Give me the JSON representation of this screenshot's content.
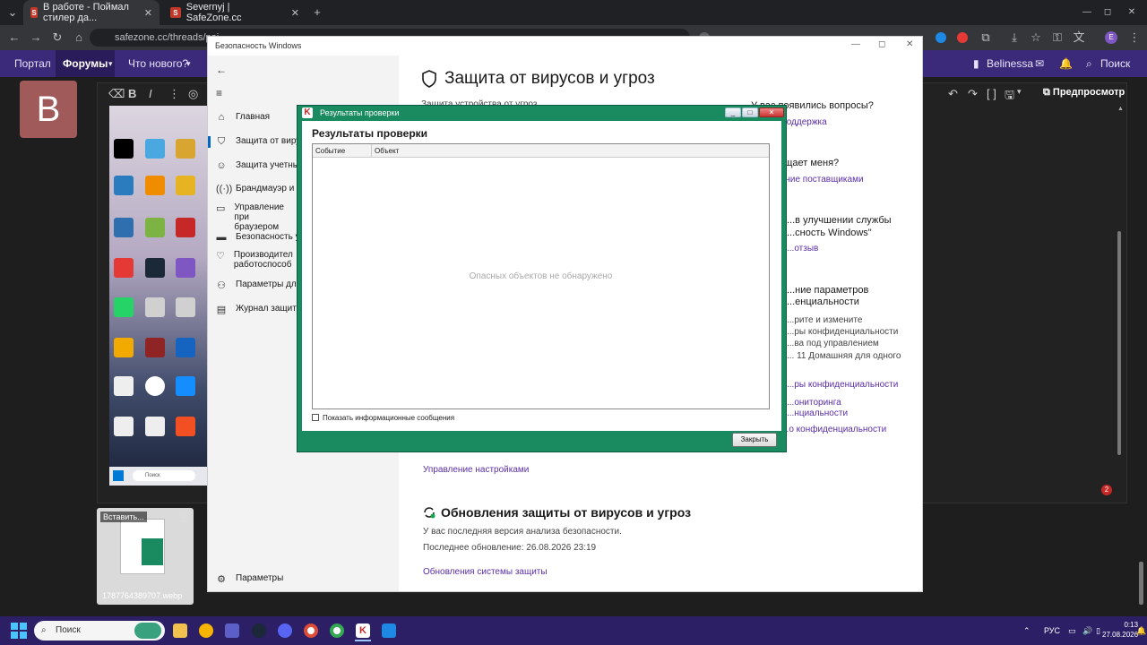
{
  "browser": {
    "tabs": [
      {
        "title": "В работе - Поймал стилер да..."
      },
      {
        "title": "Severnyj | SafeZone.cc"
      }
    ],
    "new_tab": "+",
    "url": "safezone.cc/threads/poi..."
  },
  "forum": {
    "nav": [
      "Портал",
      "Форумы",
      "Что нового?"
    ],
    "user": "Belinessa",
    "search": "Поиск",
    "preview": "Предпросмотр",
    "avatar_letter": "B",
    "thumbnail_name": "1787764389707.webp",
    "thumbnail_insert": "Вставить...",
    "notif_count": "2"
  },
  "security": {
    "window_title": "Безопасность Windows",
    "nav": [
      {
        "label": "Главная",
        "icon": "home-icon"
      },
      {
        "label": "Защита от вирус",
        "icon": "shield-icon"
      },
      {
        "label": "Защита учетных",
        "icon": "person-icon"
      },
      {
        "label": "Брандмауэр и б",
        "icon": "wifi-icon"
      },
      {
        "label": "Управление при браузером",
        "icon": "app-browser-icon"
      },
      {
        "label": "Безопасность ус",
        "icon": "laptop-icon"
      },
      {
        "label": "Производител работоспособ",
        "icon": "heart-icon"
      },
      {
        "label": "Параметры для",
        "icon": "family-icon"
      },
      {
        "label": "Журнал защиты",
        "icon": "history-icon"
      }
    ],
    "settings": "Параметры",
    "heading": "Защита от вирусов и угроз",
    "subheading": "Защита устройства от угроз",
    "side": {
      "q1": "У вас появились вопросы?",
      "q1_link": "...жная поддержка",
      "q2": "...ищает меня?",
      "q2_link": "...ние поставщиками",
      "q3a": "...в улучшении службы",
      "q3b": "...сность Windows\"",
      "q3_link": "...отзыв",
      "q4a": "...ние параметров",
      "q4b": "...енциальности",
      "p1": "...рите и измените",
      "p2": "...ры конфиденциальности",
      "p3": "...ва под управлением",
      "p4": "... 11 Домашняя для одного",
      "link1": "...ры конфиденциальности",
      "link2a": "...ониторинга",
      "link2b": "...нциальности",
      "link3": "...о конфиденциальности"
    },
    "manage_settings": "Управление настройками",
    "updates_title": "Обновления защиты от вирусов и угроз",
    "updates_status": "У вас последняя версия анализа безопасности.",
    "updates_last": "Последнее обновление: 26.08.2026 23:19",
    "updates_link": "Обновления системы защиты"
  },
  "dialog": {
    "title": "Результаты проверки",
    "heading": "Результаты проверки",
    "columns": [
      "Событие",
      "Объект"
    ],
    "empty": "Опасных объектов не обнаружено",
    "checkbox": "Показать информационные сообщения",
    "close": "Закрыть",
    "checkbox_checked": false
  },
  "taskbar": {
    "search": "Поиск",
    "lang": "РУС",
    "time": "0:13",
    "date": "27.08.2026"
  },
  "colors": {
    "dialog_frame": "#1a8a60",
    "forum_nav": "#3b2a7a",
    "taskbar": "#2c1f66",
    "link": "#5a2ea6"
  }
}
